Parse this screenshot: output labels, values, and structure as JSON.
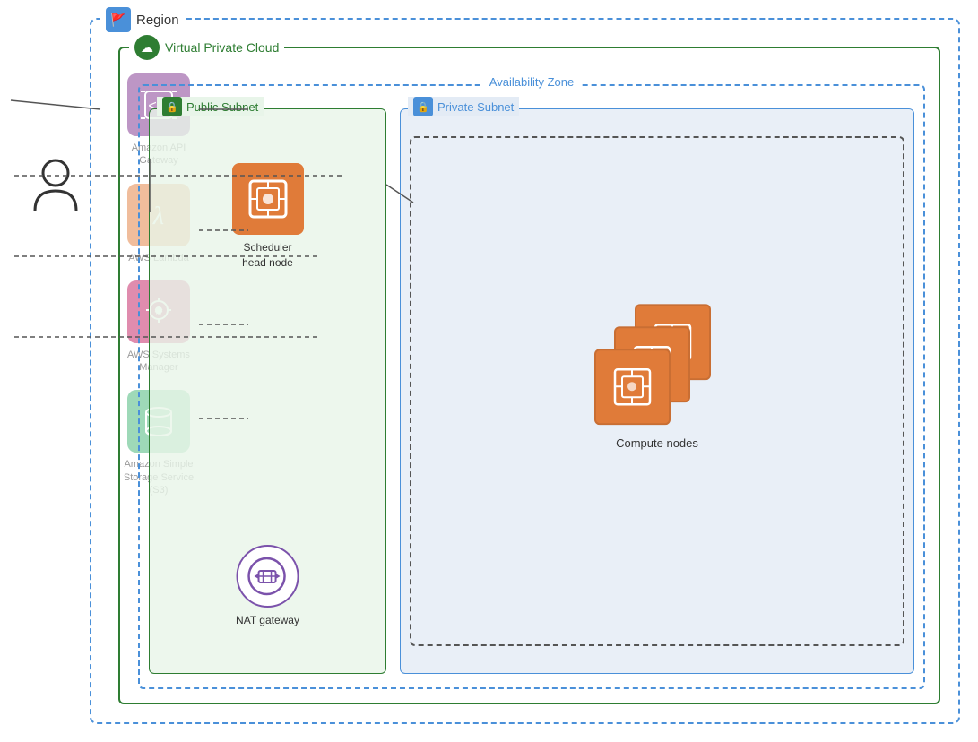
{
  "region": {
    "label": "Region",
    "vpc": {
      "label": "Virtual Private Cloud",
      "az": {
        "label": "Availability Zone",
        "public_subnet": {
          "label": "Public Subnet",
          "scheduler": {
            "label": "Scheduler\nhead node"
          },
          "nat": {
            "label": "NAT gateway"
          }
        },
        "private_subnet": {
          "label": "Private Subnet",
          "compute": {
            "label": "Compute nodes"
          }
        }
      }
    },
    "services": [
      {
        "id": "api-gateway",
        "label": "Amazon API\nGateway",
        "color": "#7b2d8b",
        "icon": "⊞"
      },
      {
        "id": "lambda",
        "label": "AWS Lambda",
        "color": "#e07b39",
        "icon": "λ"
      },
      {
        "id": "systems-manager",
        "label": "AWS Systems\nManager",
        "color": "#c0185d",
        "icon": "☁"
      },
      {
        "id": "s3",
        "label": "Amazon Simple\nStorage Service\n(S3)",
        "color": "#3cb371",
        "icon": "🪣"
      }
    ]
  }
}
